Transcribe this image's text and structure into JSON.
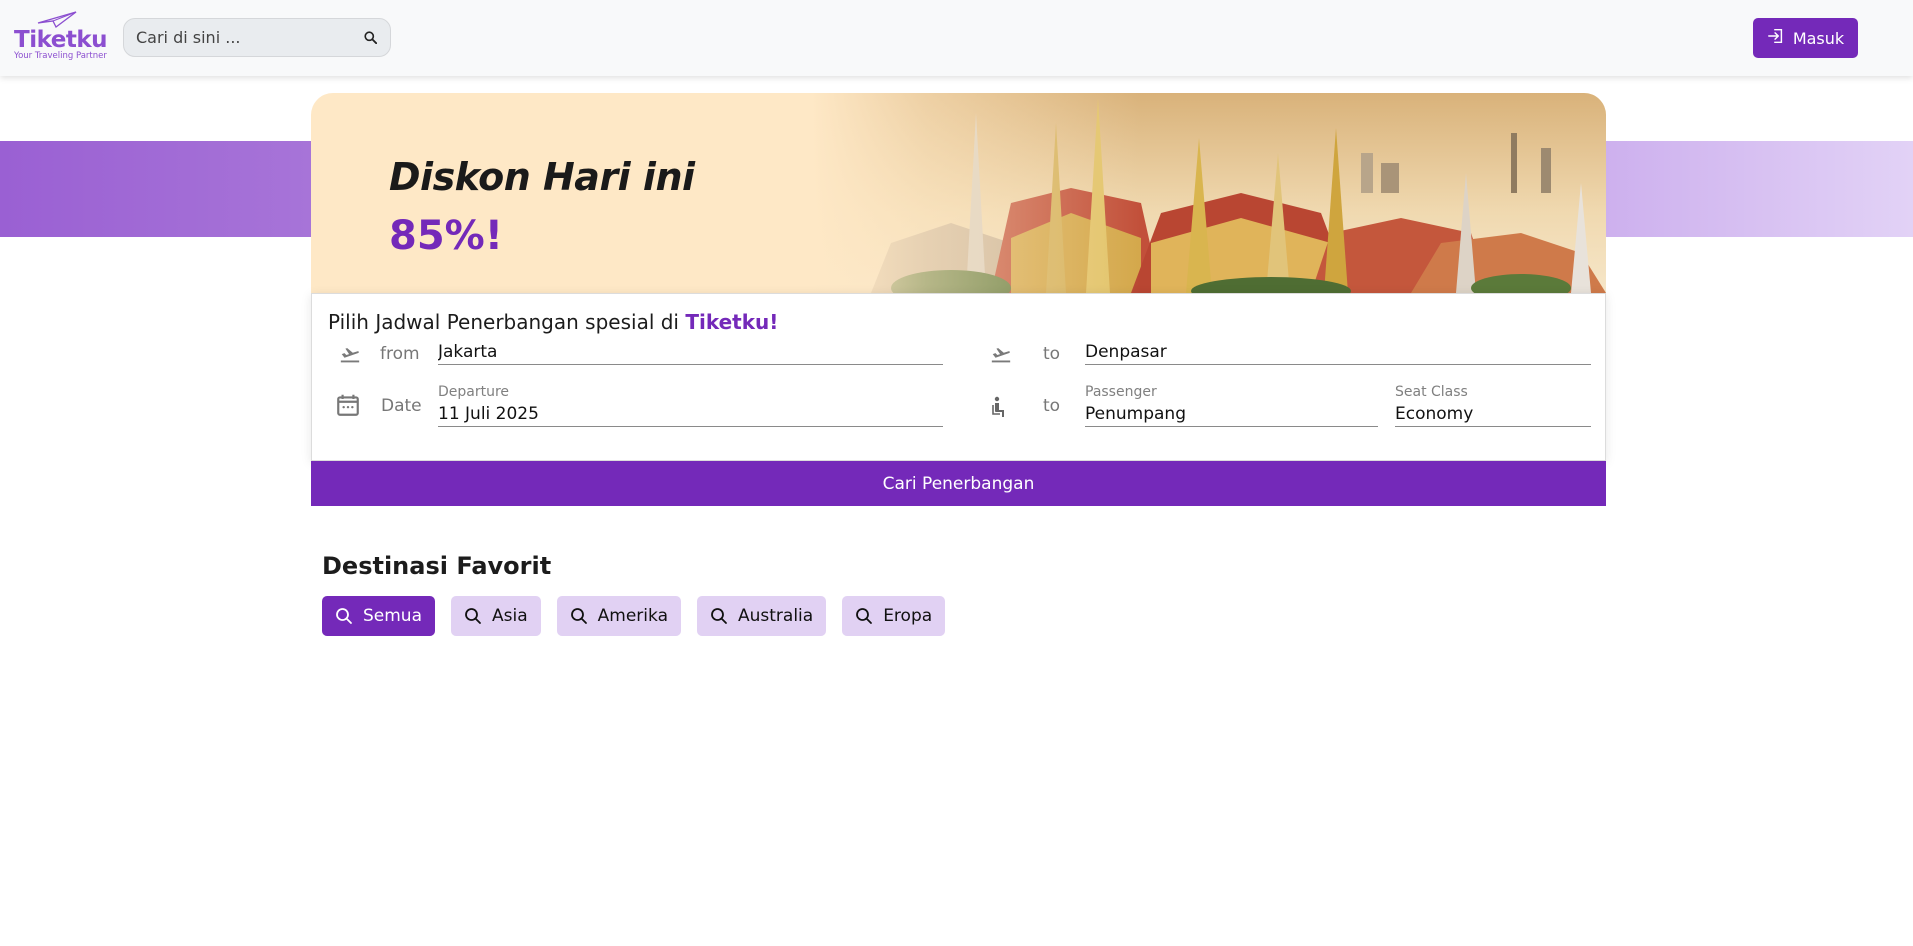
{
  "brand": {
    "name": "Tiketku",
    "tagline": "Your Traveling Partner",
    "accent": "#7429b9",
    "logo_color": "#8c4fd0"
  },
  "navbar": {
    "search_placeholder": "Cari di sini ...",
    "search_icon": "search-icon",
    "login_label": "Masuk",
    "login_icon": "login-icon"
  },
  "hero": {
    "title": "Diskon Hari ini",
    "discount": "85%!",
    "image": "bangkok-grand-palace"
  },
  "search_card": {
    "heading_prefix": "Pilih Jadwal Penerbangan spesial di ",
    "heading_brand": "Tiketku!",
    "from_label": "from",
    "from_value": "Jakarta",
    "to_label": "to",
    "to_value": "Denpasar",
    "date_label": "Date",
    "departure_caption": "Departure",
    "departure_value": "11 Juli 2025",
    "passenger_to_label": "to",
    "passenger_caption": "Passenger",
    "passenger_value": "Penumpang",
    "seat_caption": "Seat Class",
    "seat_value": "Economy",
    "submit_label": "Cari Penerbangan"
  },
  "destinations": {
    "title": "Destinasi Favorit",
    "filters": [
      {
        "label": "Semua",
        "active": true
      },
      {
        "label": "Asia",
        "active": false
      },
      {
        "label": "Amerika",
        "active": false
      },
      {
        "label": "Australia",
        "active": false
      },
      {
        "label": "Eropa",
        "active": false
      }
    ]
  }
}
